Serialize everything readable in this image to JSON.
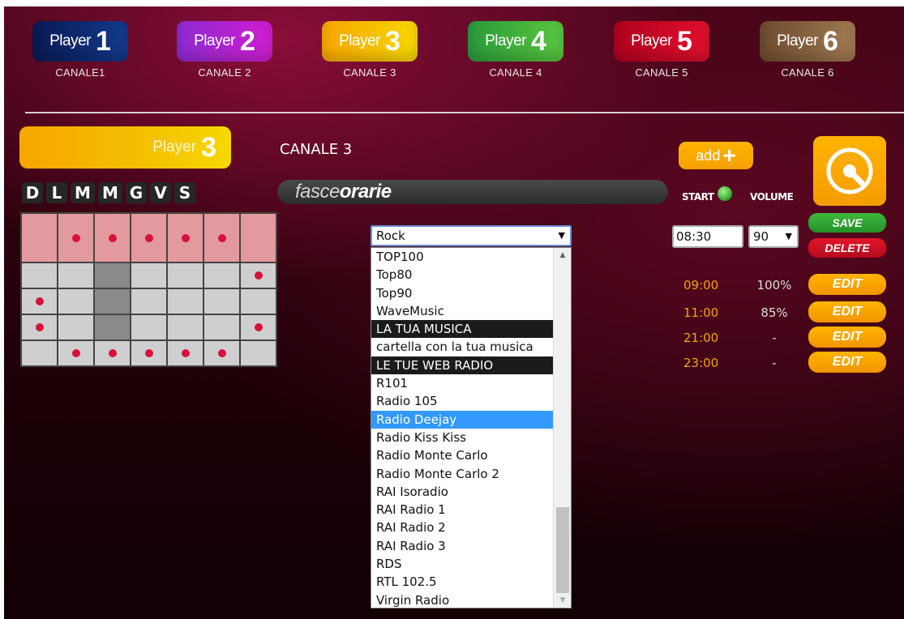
{
  "players": [
    {
      "word": "Player",
      "num": "1",
      "canale": "CANALE1",
      "color_from": "#0a1a52",
      "color_to": "#123a8c"
    },
    {
      "word": "Player",
      "num": "2",
      "canale": "CANALE 2",
      "color_from": "#8e2ad0",
      "color_to": "#d01ed0"
    },
    {
      "word": "Player",
      "num": "3",
      "canale": "CANALE 3",
      "color_from": "#f7a600",
      "color_to": "#f7d800"
    },
    {
      "word": "Player",
      "num": "4",
      "canale": "CANALE 4",
      "color_from": "#2a9a3a",
      "color_to": "#59c53f"
    },
    {
      "word": "Player",
      "num": "5",
      "canale": "CANALE 5",
      "color_from": "#b0001f",
      "color_to": "#e0102e"
    },
    {
      "word": "Player",
      "num": "6",
      "canale": "CANALE 6",
      "color_from": "#6e4a2e",
      "color_to": "#a07a52"
    }
  ],
  "current": {
    "word": "Player",
    "num": "3",
    "canale": "CANALE 3"
  },
  "days": [
    "D",
    "L",
    "M",
    "M",
    "G",
    "V",
    "S"
  ],
  "fasce": {
    "light": "fasce",
    "bold": "orarie"
  },
  "grid": {
    "dots": [
      [
        0,
        1,
        1,
        1,
        1,
        1,
        0
      ],
      [
        0,
        0,
        0,
        0,
        0,
        0,
        1
      ],
      [
        1,
        0,
        0,
        0,
        0,
        0,
        0
      ],
      [
        1,
        0,
        0,
        0,
        0,
        0,
        1
      ],
      [
        0,
        1,
        1,
        1,
        1,
        1,
        0
      ]
    ],
    "dark": [
      [
        0,
        0,
        0,
        0,
        0,
        0,
        0
      ],
      [
        0,
        0,
        1,
        0,
        0,
        0,
        0
      ],
      [
        0,
        0,
        1,
        0,
        0,
        0,
        0
      ],
      [
        0,
        0,
        1,
        0,
        0,
        0,
        0
      ],
      [
        0,
        0,
        0,
        0,
        0,
        0,
        0
      ]
    ]
  },
  "select": {
    "value": "Rock",
    "options": [
      {
        "label": "TOP100",
        "type": "normal"
      },
      {
        "label": "Top80",
        "type": "normal"
      },
      {
        "label": "Top90",
        "type": "normal"
      },
      {
        "label": "WaveMusic",
        "type": "normal"
      },
      {
        "label": "LA TUA MUSICA",
        "type": "group"
      },
      {
        "label": "cartella con la tua musica",
        "type": "normal"
      },
      {
        "label": "LE TUE WEB RADIO",
        "type": "group"
      },
      {
        "label": "R101",
        "type": "normal"
      },
      {
        "label": "Radio 105",
        "type": "normal"
      },
      {
        "label": "Radio Deejay",
        "type": "highlight"
      },
      {
        "label": "Radio Kiss Kiss",
        "type": "normal"
      },
      {
        "label": "Radio Monte Carlo",
        "type": "normal"
      },
      {
        "label": "Radio Monte Carlo 2",
        "type": "normal"
      },
      {
        "label": "RAI Isoradio",
        "type": "normal"
      },
      {
        "label": "RAI Radio 1",
        "type": "normal"
      },
      {
        "label": "RAI Radio 2",
        "type": "normal"
      },
      {
        "label": "RAI Radio 3",
        "type": "normal"
      },
      {
        "label": "RDS",
        "type": "normal"
      },
      {
        "label": "RTL 102.5",
        "type": "normal"
      },
      {
        "label": "Virgin Radio",
        "type": "normal"
      }
    ]
  },
  "right": {
    "add_label": "add",
    "add_plus": "+",
    "start_label": "START",
    "volume_label": "VOLUME",
    "time_value": "08:30",
    "volume_value": "90",
    "save_label": "SAVE",
    "delete_label": "DELETE",
    "schedule": [
      {
        "time": "09:00",
        "volume": "100%",
        "edit": "EDIT"
      },
      {
        "time": "11:00",
        "volume": "85%",
        "edit": "EDIT"
      },
      {
        "time": "21:00",
        "volume": "-",
        "edit": "EDIT"
      },
      {
        "time": "23:00",
        "volume": "-",
        "edit": "EDIT"
      }
    ]
  }
}
